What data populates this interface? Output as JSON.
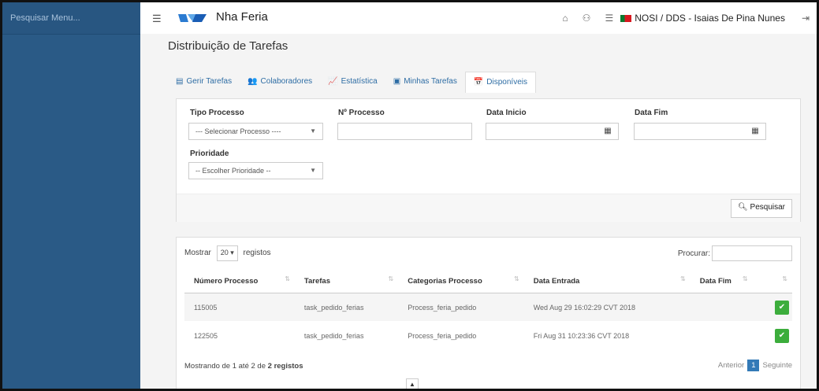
{
  "sidebar": {
    "search_placeholder": "Pesquisar Menu..."
  },
  "header": {
    "app_title": "Nha Feria",
    "user": "NOSI / DDS - Isaias De Pina Nunes",
    "icons": [
      "home-icon",
      "sitemap-icon",
      "list-icon",
      "logout-icon"
    ]
  },
  "page": {
    "title": "Distribuição de Tarefas",
    "tabs": [
      {
        "label": "Gerir Tarefas"
      },
      {
        "label": "Colaboradores"
      },
      {
        "label": "Estatística"
      },
      {
        "label": "Minhas Tarefas"
      },
      {
        "label": "Disponíveis"
      }
    ]
  },
  "form": {
    "tipo_processo_label": "Tipo Processo",
    "tipo_processo_value": "--- Selecionar Processo ----",
    "num_processo_label": "Nº Processo",
    "data_inicio_label": "Data Inicio",
    "data_fim_label": "Data Fim",
    "prioridade_label": "Prioridade",
    "prioridade_value": "-- Escolher Prioridade --",
    "search_button": "Pesquisar"
  },
  "table": {
    "show_label": "Mostrar",
    "page_size": "20",
    "records_label": "registos",
    "search_label": "Procurar:",
    "headers": [
      "Número Processo",
      "Tarefas",
      "Categorias Processo",
      "Data Entrada",
      "Data Fim"
    ],
    "rows": [
      {
        "numero": "115005",
        "tarefa": "task_pedido_ferias",
        "categoria": "Process_feria_pedido",
        "entrada": "Wed Aug 29 16:02:29 CVT 2018",
        "fim": ""
      },
      {
        "numero": "122505",
        "tarefa": "task_pedido_ferias",
        "categoria": "Process_feria_pedido",
        "entrada": "Fri Aug 31 10:23:36 CVT 2018",
        "fim": ""
      }
    ],
    "footer_prefix": "Mostrando de 1 até 2 de",
    "footer_total": "2 registos",
    "pager_prev": "Anterior",
    "pager_page": "1",
    "pager_next": "Seguinte"
  }
}
